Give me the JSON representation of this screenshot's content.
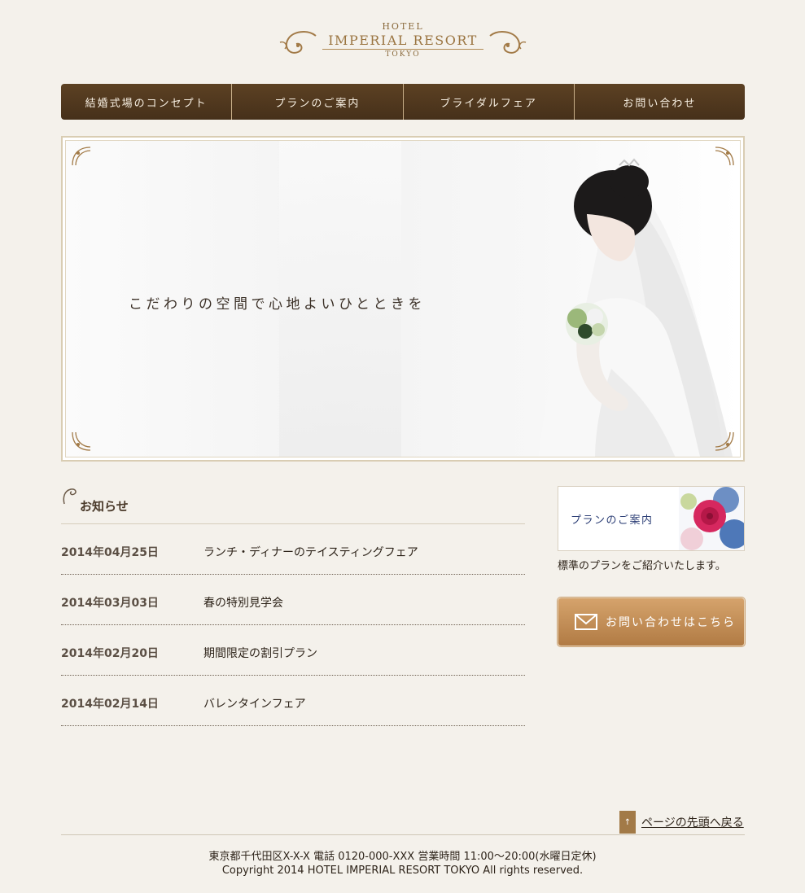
{
  "logo": {
    "hotel": "HOTEL",
    "name": "IMPERIAL RESORT",
    "city": "TOKYO"
  },
  "nav": {
    "items": [
      {
        "label": "結婚式場のコンセプト"
      },
      {
        "label": "プランのご案内"
      },
      {
        "label": "ブライダルフェア"
      },
      {
        "label": "お問い合わせ"
      }
    ]
  },
  "hero": {
    "copy": "こだわりの空間で心地よいひとときを"
  },
  "news": {
    "title": "お知らせ",
    "items": [
      {
        "date": "2014年04月25日",
        "text": "ランチ・ディナーのテイスティングフェア"
      },
      {
        "date": "2014年03月03日",
        "text": "春の特別見学会"
      },
      {
        "date": "2014年02月20日",
        "text": "期間限定の割引プラン"
      },
      {
        "date": "2014年02月14日",
        "text": "バレンタインフェア"
      }
    ]
  },
  "sidebar": {
    "plan_label": "プランのご案内",
    "plan_desc": "標準のプランをご紹介いたします。",
    "contact_label": "お問い合わせはこちら"
  },
  "footer": {
    "pagetop_label": "ページの先頭へ戻る",
    "address": "東京都千代田区X-X-X 電話 0120-000-XXX 営業時間 11:00〜20:00(水曜日定休)",
    "copyright": "Copyright 2014 HOTEL IMPERIAL RESORT TOKYO All rights reserved."
  },
  "colors": {
    "background": "#f4f1eb",
    "nav": "#4f361d",
    "gold": "#b17b44",
    "plan_text": "#2e4077"
  }
}
